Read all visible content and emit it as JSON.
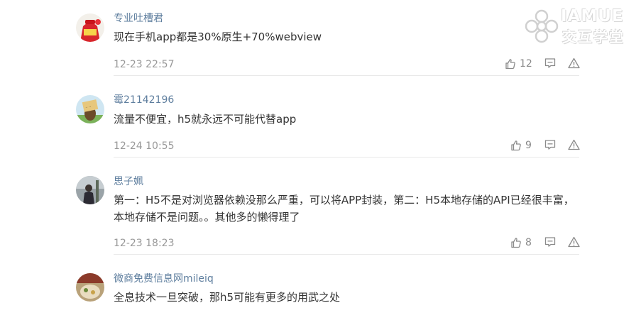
{
  "watermark": {
    "title": "IAMUE",
    "subtitle": "交互学堂"
  },
  "comments": [
    {
      "username": "专业吐槽君",
      "content": "现在手机app都是30%原生+70%webview",
      "time": "12-23 22:57",
      "likes": "12"
    },
    {
      "username": "霉21142196",
      "content": "流量不便宜，h5就永远不可能代替app",
      "time": "12-24 10:55",
      "likes": "9"
    },
    {
      "username": "思子姵",
      "content": "第一：H5不是对浏览器依赖没那么严重，可以将APP封装，第二：H5本地存储的API已经很丰富，本地存储不是问题。。其他多的懒得理了",
      "time": "12-23 18:23",
      "likes": "8"
    },
    {
      "username": "微商免费信息网mileiq",
      "content": "全息技术一旦突破，那h5可能有更多的用武之处",
      "time": "",
      "likes": ""
    }
  ],
  "icons": {
    "like": "thumbs-up-icon",
    "reply": "comment-icon",
    "report": "warning-icon"
  }
}
